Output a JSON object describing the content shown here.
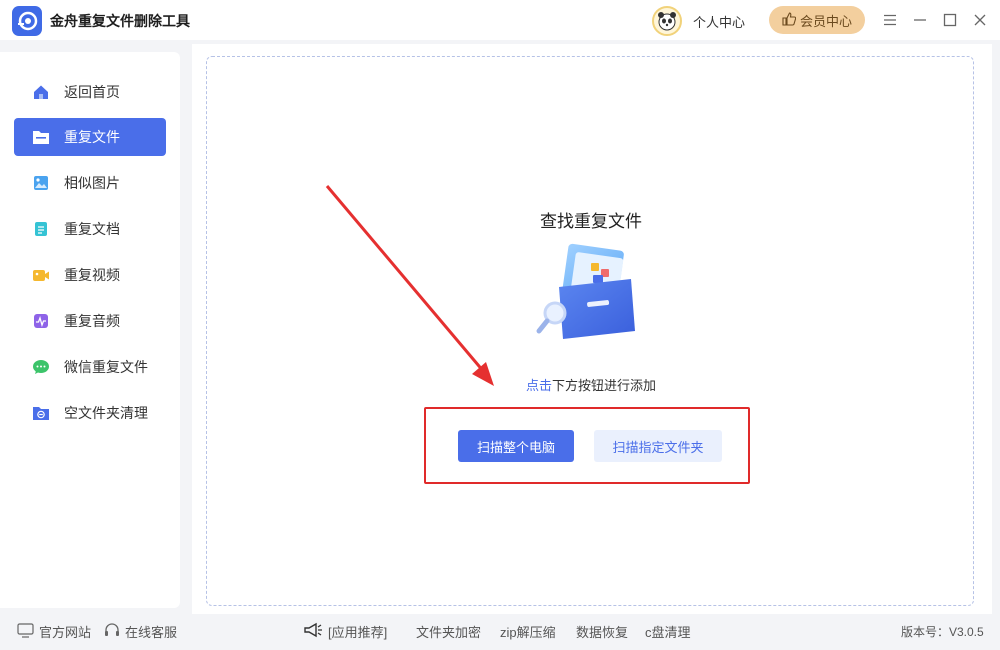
{
  "app": {
    "title": "金舟重复文件删除工具"
  },
  "header": {
    "user_center": "个人中心",
    "vip_center": "会员中心"
  },
  "sidebar": {
    "items": [
      {
        "label": "返回首页",
        "icon": "home-icon",
        "color": "#4a6ee9"
      },
      {
        "label": "重复文件",
        "icon": "folder-icon",
        "color": "#ffffff",
        "active": true
      },
      {
        "label": "相似图片",
        "icon": "image-icon",
        "color": "#4aa3ef"
      },
      {
        "label": "重复文档",
        "icon": "document-icon",
        "color": "#35c3d4"
      },
      {
        "label": "重复视频",
        "icon": "video-icon",
        "color": "#f5b82e"
      },
      {
        "label": "重复音频",
        "icon": "audio-icon",
        "color": "#8e63e8"
      },
      {
        "label": "微信重复文件",
        "icon": "wechat-icon",
        "color": "#3cc46a"
      },
      {
        "label": "空文件夹清理",
        "icon": "empty-folder-icon",
        "color": "#4a6ee9"
      }
    ]
  },
  "main": {
    "title": "查找重复文件",
    "hint_highlight": "点击",
    "hint_rest": "下方按钮进行添加",
    "scan_all_label": "扫描整个电脑",
    "scan_folder_label": "扫描指定文件夹"
  },
  "footer": {
    "official_site": "官方网站",
    "online_service": "在线客服",
    "recommend": "[应用推荐]",
    "links": [
      "文件夹加密",
      "zip解压缩",
      "数据恢复",
      "c盘清理"
    ],
    "version": "版本号：V3.0.5"
  },
  "colors": {
    "accent": "#4a6ee9",
    "vip": "#f3cf9e",
    "annotation": "#e02a2a"
  }
}
